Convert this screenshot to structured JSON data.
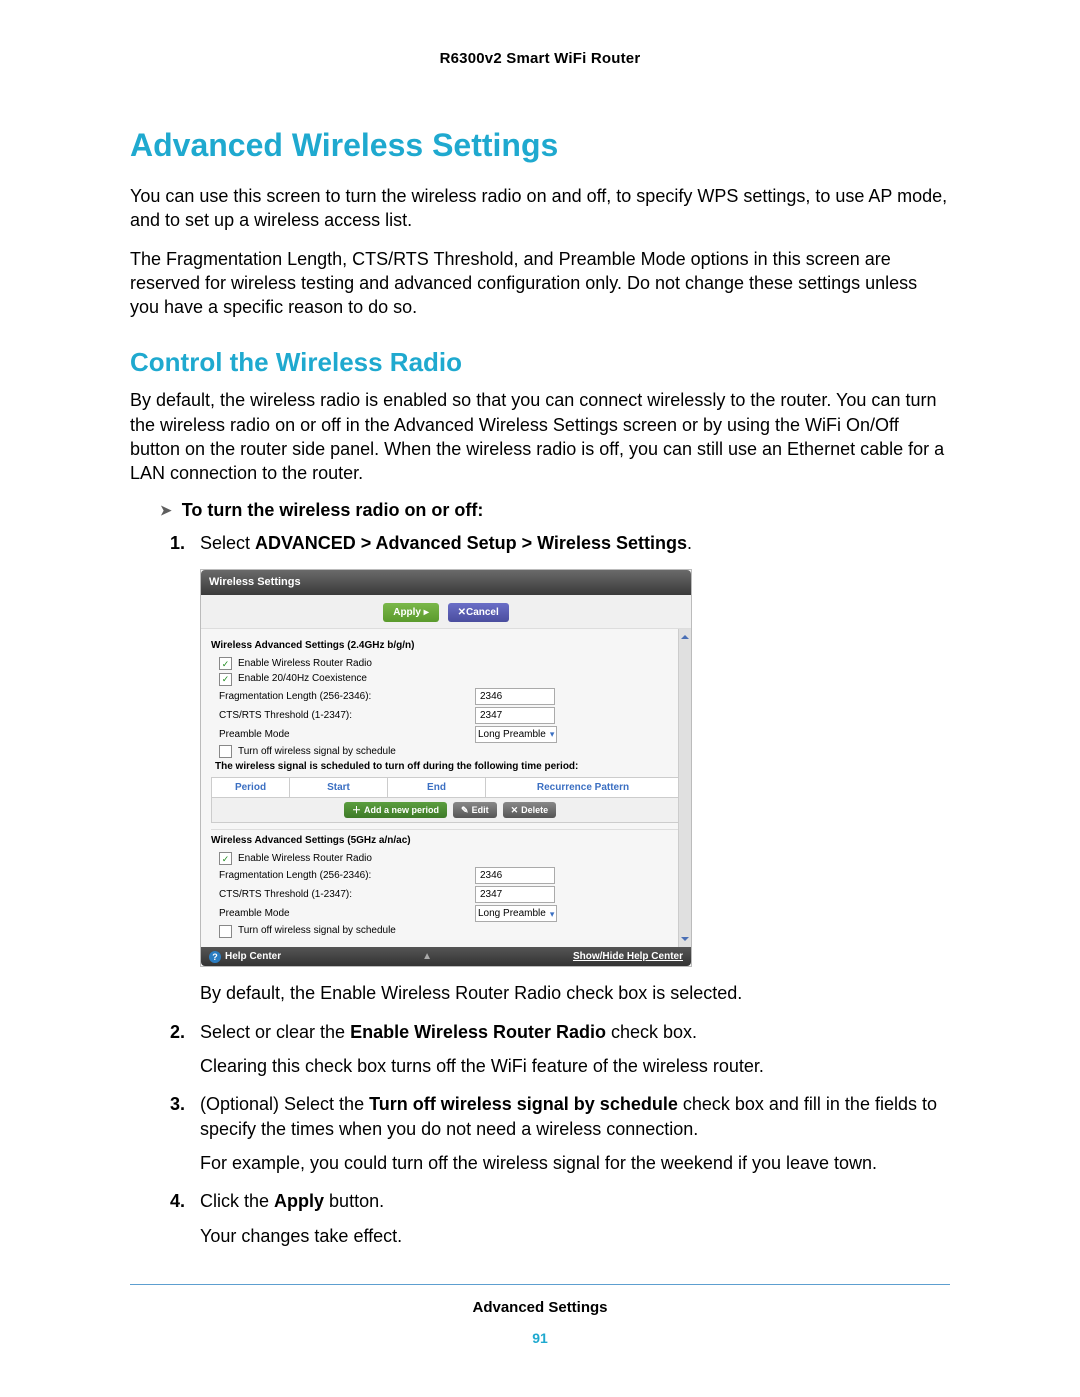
{
  "page": {
    "device_header": "R6300v2 Smart WiFi Router",
    "title": "Advanced Wireless Settings",
    "intro1": "You can use this screen to turn the wireless radio on and off, to specify WPS settings, to use AP mode, and to set up a wireless access list.",
    "intro2": "The Fragmentation Length, CTS/RTS Threshold, and Preamble Mode options in this screen are reserved for wireless testing and advanced configuration only. Do not change these settings unless you have a specific reason to do so."
  },
  "section": {
    "title": "Control the Wireless Radio",
    "para": "By default, the wireless radio is enabled so that you can connect wirelessly to the router. You can turn the wireless radio on or off in the Advanced Wireless Settings screen or by using the WiFi On/Off button on the router side panel. When the wireless radio is off, you can still use an Ethernet cable for a LAN connection to the router."
  },
  "proc": {
    "lead": "To turn the wireless radio on or off:"
  },
  "steps": {
    "s1_prefix": "Select ",
    "s1_bold": "ADVANCED > Advanced Setup > Wireless Settings",
    "s1_after": "By default, the Enable Wireless Router Radio check box is selected.",
    "s2_prefix": "Select or clear the ",
    "s2_bold": "Enable Wireless Router Radio",
    "s2_suffix": " check box.",
    "s2_after": "Clearing this check box turns off the WiFi feature of the wireless router.",
    "s3_prefix": "(Optional) Select the ",
    "s3_bold": "Turn off wireless signal by schedule",
    "s3_suffix": " check box and fill in the fields to specify the times when you do not need a wireless connection.",
    "s3_after": "For example, you could turn off the wireless signal for the weekend if you leave town.",
    "s4_prefix": "Click the ",
    "s4_bold": "Apply",
    "s4_suffix": " button.",
    "s4_after": "Your changes take effect."
  },
  "ui": {
    "title": "Wireless Settings",
    "apply": "Apply ▸",
    "cancel": "Cancel",
    "sec24": "Wireless Advanced Settings (2.4GHz b/g/n)",
    "sec5": "Wireless Advanced Settings (5GHz a/n/ac)",
    "enable_radio": "Enable Wireless Router Radio",
    "coexist": "Enable 20/40Hz Coexistence",
    "frag_label": "Fragmentation Length (256-2346):",
    "frag_value": "2346",
    "cts_label": "CTS/RTS Threshold (1-2347):",
    "cts_value": "2347",
    "preamble_label": "Preamble Mode",
    "preamble_value": "Long Preamble",
    "turnoff": "Turn off wireless signal by schedule",
    "schedule_note": "The wireless signal is scheduled to turn off during the following time period:",
    "col_period": "Period",
    "col_start": "Start",
    "col_end": "End",
    "col_recur": "Recurrence Pattern",
    "btn_add": "Add a new period",
    "btn_edit": "Edit",
    "btn_delete": "Delete",
    "help": "Help Center",
    "show_hide": "Show/Hide Help Center"
  },
  "footer": {
    "section": "Advanced Settings",
    "page_number": "91"
  }
}
